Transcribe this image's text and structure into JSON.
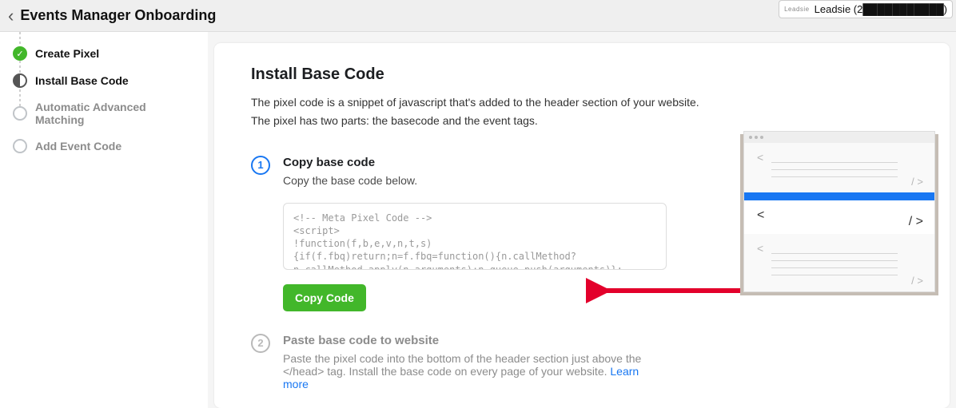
{
  "header": {
    "title": "Events Manager Onboarding",
    "account_logo": "Leadsie",
    "account_name": "Leadsie (2███████████)"
  },
  "sidebar": {
    "steps": [
      {
        "label": "Create Pixel",
        "state": "done"
      },
      {
        "label": "Install Base Code",
        "state": "current"
      },
      {
        "label": "Automatic Advanced Matching",
        "state": "upcoming"
      },
      {
        "label": "Add Event Code",
        "state": "upcoming"
      }
    ]
  },
  "main": {
    "title": "Install Base Code",
    "desc1": "The pixel code is a snippet of javascript that's added to the header section of your website.",
    "desc2": "The pixel has two parts: the basecode and the event tags.",
    "step1": {
      "num": "1",
      "title": "Copy base code",
      "sub": "Copy the base code below.",
      "code": "<!-- Meta Pixel Code -->\n<script>\n!function(f,b,e,v,n,t,s)\n{if(f.fbq)return;n=f.fbq=function(){n.callMethod?\nn.callMethod.apply(n,arguments):n.queue.push(arguments)};",
      "copy_btn": "Copy Code"
    },
    "step2": {
      "num": "2",
      "title": "Paste base code to website",
      "sub_a": "Paste the pixel code into the bottom of the header section just above the </head> tag. Install the base code on every page of your website. ",
      "learn_more": "Learn more"
    }
  }
}
